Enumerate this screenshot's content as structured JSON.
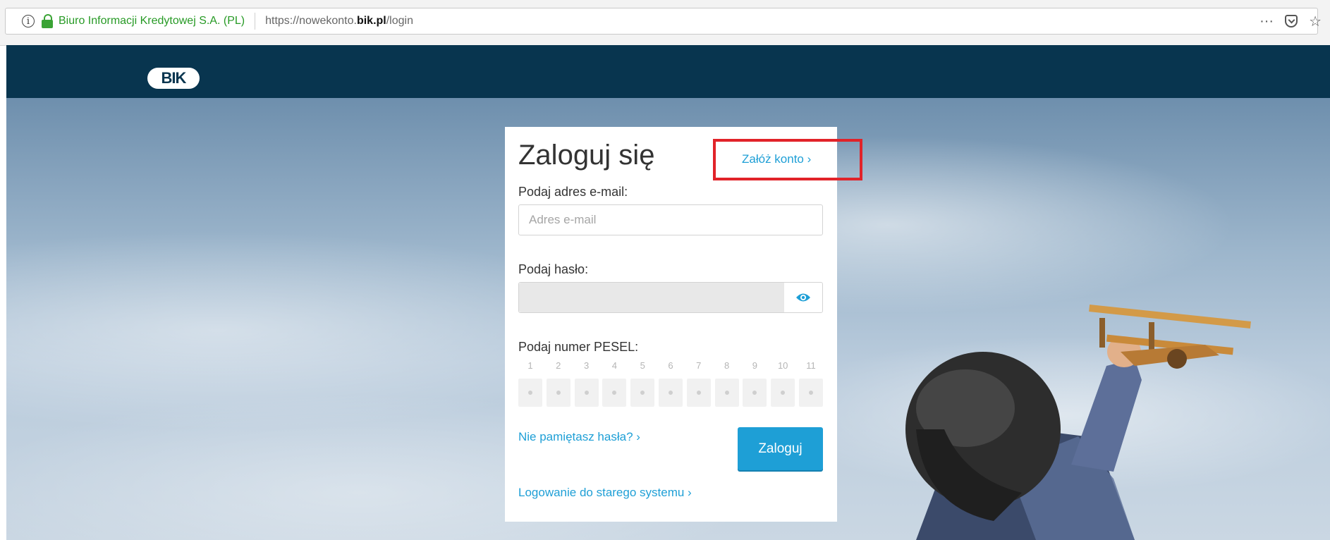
{
  "browser": {
    "site_identity": "Biuro Informacji Kredytowej S.A. (PL)",
    "url_prefix": "https://nowekonto.",
    "url_domain": "bik.pl",
    "url_path": "/login",
    "menu_glyph": "···",
    "star_glyph": "☆"
  },
  "header": {
    "logo_text": "BIK",
    "background": "#08354f"
  },
  "login": {
    "title": "Zaloguj się",
    "register_link": "Załóż konto ›",
    "email_label": "Podaj adres e-mail:",
    "email_placeholder": "Adres e-mail",
    "email_value": "",
    "password_label": "Podaj hasło:",
    "password_value": "",
    "pesel_label": "Podaj numer PESEL:",
    "pesel_positions": [
      "1",
      "2",
      "3",
      "4",
      "5",
      "6",
      "7",
      "8",
      "9",
      "10",
      "11"
    ],
    "forgot_link": "Nie pamiętasz hasła? ›",
    "submit_label": "Zaloguj",
    "old_system_link": "Logowanie do starego systemu ›"
  },
  "colors": {
    "accent": "#1e9fd6",
    "highlight": "#e12329",
    "secure_green": "#279a25"
  }
}
